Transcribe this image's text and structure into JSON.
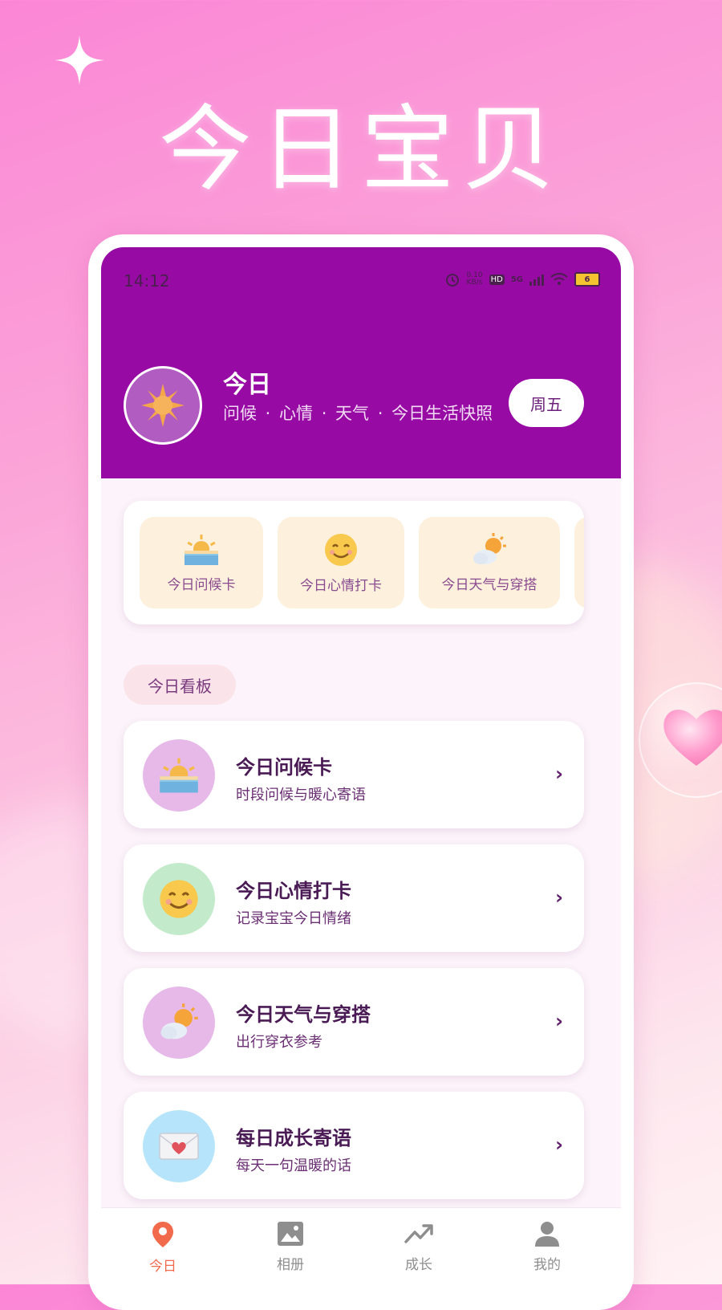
{
  "poster": {
    "title": "今日宝贝"
  },
  "status_bar": {
    "time": "14:12",
    "net_speed_value": "0.10",
    "net_speed_unit": "KB/s",
    "hd_label": "HD",
    "network": "5G",
    "battery": "6"
  },
  "header": {
    "title": "今日",
    "subtitle": "问候 · 心情 · 天气 · 今日生活快照",
    "weekday_button": "周五"
  },
  "quick_actions": [
    {
      "label": "今日问候卡",
      "icon": "sunrise-icon"
    },
    {
      "label": "今日心情打卡",
      "icon": "smile-icon"
    },
    {
      "label": "今日天气与穿搭",
      "icon": "sun-cloud-icon"
    }
  ],
  "section": {
    "title": "今日看板"
  },
  "cards": [
    {
      "title": "今日问候卡",
      "desc": "时段问候与暖心寄语",
      "icon": "sunrise-icon",
      "icon_bg": "#e6b9e9"
    },
    {
      "title": "今日心情打卡",
      "desc": "记录宝宝今日情绪",
      "icon": "smile-icon",
      "icon_bg": "#c3ebcb"
    },
    {
      "title": "今日天气与穿搭",
      "desc": "出行穿衣参考",
      "icon": "sun-cloud-icon",
      "icon_bg": "#e6b9e9"
    },
    {
      "title": "每日成长寄语",
      "desc": "每天一句温暖的话",
      "icon": "love-letter-icon",
      "icon_bg": "#b6e5fb"
    }
  ],
  "chevron": "›",
  "tabs": [
    {
      "label": "今日",
      "icon": "location-pin-icon",
      "active": true
    },
    {
      "label": "相册",
      "icon": "image-icon",
      "active": false
    },
    {
      "label": "成长",
      "icon": "trend-icon",
      "active": false
    },
    {
      "label": "我的",
      "icon": "person-icon",
      "active": false
    }
  ],
  "colors": {
    "header_bg": "#970aa4",
    "active_tab": "#f26a4c",
    "inactive_tab": "#8e8e8e",
    "tile_bg": "#fdf0dc",
    "section_pill_bg": "#fbe3ea"
  }
}
